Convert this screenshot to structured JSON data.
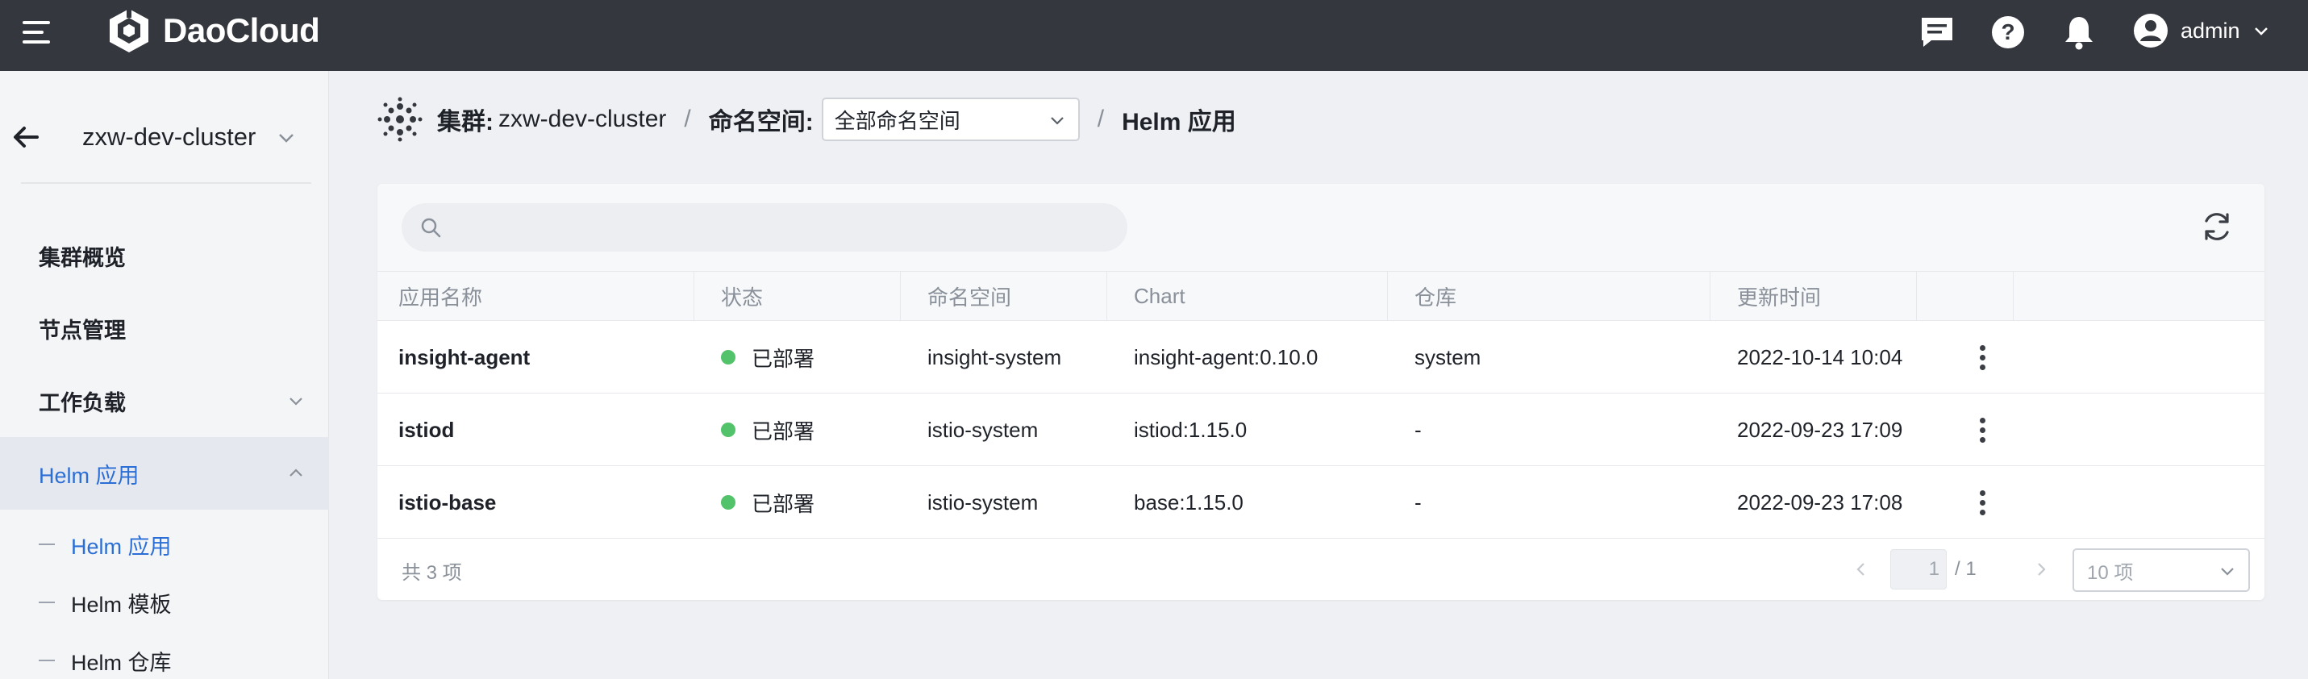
{
  "brand": {
    "name": "DaoCloud"
  },
  "topbar": {
    "user": "admin",
    "icons": [
      "message-icon",
      "help-icon",
      "bell-icon",
      "user-avatar-icon"
    ]
  },
  "sidebar": {
    "cluster": "zxw-dev-cluster",
    "items": [
      {
        "label": "集群概览"
      },
      {
        "label": "节点管理"
      },
      {
        "label": "工作负载"
      },
      {
        "label": "Helm 应用"
      }
    ],
    "subitems": [
      {
        "label": "Helm 应用"
      },
      {
        "label": "Helm 模板"
      },
      {
        "label": "Helm 仓库"
      }
    ]
  },
  "breadcrumb": {
    "cluster_label": "集群:",
    "cluster_value": "zxw-dev-cluster",
    "sep1": "/",
    "namespace_label": "命名空间:",
    "namespace_value": "全部命名空间",
    "sep2": "/",
    "current": "Helm 应用"
  },
  "search": {
    "placeholder": "",
    "value": ""
  },
  "table": {
    "headers": [
      "应用名称",
      "状态",
      "命名空间",
      "Chart",
      "仓库",
      "更新时间",
      ""
    ],
    "rows": [
      {
        "name": "insight-agent",
        "status": "已部署",
        "namespace": "insight-system",
        "chart": "insight-agent:0.10.0",
        "repo": "system",
        "updated": "2022-10-14 10:04"
      },
      {
        "name": "istiod",
        "status": "已部署",
        "namespace": "istio-system",
        "chart": "istiod:1.15.0",
        "repo": "-",
        "updated": "2022-09-23 17:09"
      },
      {
        "name": "istio-base",
        "status": "已部署",
        "namespace": "istio-system",
        "chart": "base:1.15.0",
        "repo": "-",
        "updated": "2022-09-23 17:08"
      }
    ]
  },
  "footer": {
    "total": "共 3 项",
    "page": "1",
    "page_total": "/ 1",
    "page_size": "10 项"
  },
  "colors": {
    "topbar": "#34373d",
    "accent": "#2b6fd6",
    "status_ok": "#52c26b"
  }
}
